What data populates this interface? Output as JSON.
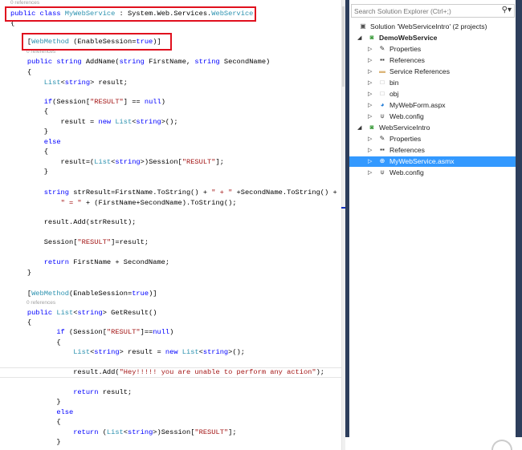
{
  "editor": {
    "codelens": [
      "0 references",
      "0 references",
      "0 references"
    ],
    "lines": [
      [
        {
          "t": "public class ",
          "c": "kw"
        },
        {
          "t": "MyWebService",
          "c": "type"
        },
        {
          "t": " : System.Web.Services.",
          "c": ""
        },
        {
          "t": "WebService",
          "c": "type"
        }
      ],
      [
        {
          "t": "{",
          "c": ""
        }
      ],
      [
        {
          "t": "    [",
          "c": ""
        },
        {
          "t": "WebMethod",
          "c": "type"
        },
        {
          "t": " (EnableSession=",
          "c": ""
        },
        {
          "t": "true",
          "c": "kw"
        },
        {
          "t": ")]",
          "c": ""
        }
      ],
      [
        {
          "t": "    public string ",
          "c": "kw"
        },
        {
          "t": "AddName(",
          "c": ""
        },
        {
          "t": "string ",
          "c": "kw"
        },
        {
          "t": "FirstName, ",
          "c": ""
        },
        {
          "t": "string ",
          "c": "kw"
        },
        {
          "t": "SecondName)",
          "c": ""
        }
      ],
      [
        {
          "t": "    {",
          "c": ""
        }
      ],
      [
        {
          "t": "        List",
          "c": "type"
        },
        {
          "t": "<",
          "c": ""
        },
        {
          "t": "string",
          "c": "kw"
        },
        {
          "t": "> result;",
          "c": ""
        }
      ],
      [
        {
          "t": "        if",
          "c": "kw"
        },
        {
          "t": "(Session[",
          "c": ""
        },
        {
          "t": "\"RESULT\"",
          "c": "str"
        },
        {
          "t": "] == ",
          "c": ""
        },
        {
          "t": "null",
          "c": "kw"
        },
        {
          "t": ")",
          "c": ""
        }
      ],
      [
        {
          "t": "        {",
          "c": ""
        }
      ],
      [
        {
          "t": "            result = ",
          "c": ""
        },
        {
          "t": "new ",
          "c": "kw"
        },
        {
          "t": "List",
          "c": "type"
        },
        {
          "t": "<",
          "c": ""
        },
        {
          "t": "string",
          "c": "kw"
        },
        {
          "t": ">();",
          "c": ""
        }
      ],
      [
        {
          "t": "        }",
          "c": ""
        }
      ],
      [
        {
          "t": "        else",
          "c": "kw"
        }
      ],
      [
        {
          "t": "        {",
          "c": ""
        }
      ],
      [
        {
          "t": "            result=(",
          "c": ""
        },
        {
          "t": "List",
          "c": "type"
        },
        {
          "t": "<",
          "c": ""
        },
        {
          "t": "string",
          "c": "kw"
        },
        {
          "t": ">)Session[",
          "c": ""
        },
        {
          "t": "\"RESULT\"",
          "c": "str"
        },
        {
          "t": "];",
          "c": ""
        }
      ],
      [
        {
          "t": "        }",
          "c": ""
        }
      ],
      [
        {
          "t": "        string ",
          "c": "kw"
        },
        {
          "t": "strResult=FirstName.ToString() + ",
          "c": ""
        },
        {
          "t": "\" + \"",
          "c": "str"
        },
        {
          "t": " +SecondName.ToString() +",
          "c": ""
        }
      ],
      [
        {
          "t": "            ",
          "c": ""
        },
        {
          "t": "\" = \"",
          "c": "str"
        },
        {
          "t": " + (FirstName+SecondName).ToString();",
          "c": ""
        }
      ],
      [
        {
          "t": "        result.Add(strResult);",
          "c": ""
        }
      ],
      [
        {
          "t": "        Session[",
          "c": ""
        },
        {
          "t": "\"RESULT\"",
          "c": "str"
        },
        {
          "t": "]=result;",
          "c": ""
        }
      ],
      [
        {
          "t": "        return ",
          "c": "kw"
        },
        {
          "t": "FirstName + SecondName;",
          "c": ""
        }
      ],
      [
        {
          "t": "    }",
          "c": ""
        }
      ],
      [
        {
          "t": "    [",
          "c": ""
        },
        {
          "t": "WebMethod",
          "c": "type"
        },
        {
          "t": "(EnableSession=",
          "c": ""
        },
        {
          "t": "true",
          "c": "kw"
        },
        {
          "t": ")]",
          "c": ""
        }
      ],
      [
        {
          "t": "    public ",
          "c": "kw"
        },
        {
          "t": "List",
          "c": "type"
        },
        {
          "t": "<",
          "c": ""
        },
        {
          "t": "string",
          "c": "kw"
        },
        {
          "t": "> GetResult()",
          "c": ""
        }
      ],
      [
        {
          "t": "    {",
          "c": ""
        }
      ],
      [
        {
          "t": "           if ",
          "c": "kw"
        },
        {
          "t": "(Session[",
          "c": ""
        },
        {
          "t": "\"RESULT\"",
          "c": "str"
        },
        {
          "t": "]==",
          "c": ""
        },
        {
          "t": "null",
          "c": "kw"
        },
        {
          "t": ")",
          "c": ""
        }
      ],
      [
        {
          "t": "           {",
          "c": ""
        }
      ],
      [
        {
          "t": "               List",
          "c": "type"
        },
        {
          "t": "<",
          "c": ""
        },
        {
          "t": "string",
          "c": "kw"
        },
        {
          "t": "> result = ",
          "c": ""
        },
        {
          "t": "new ",
          "c": "kw"
        },
        {
          "t": "List",
          "c": "type"
        },
        {
          "t": "<",
          "c": ""
        },
        {
          "t": "string",
          "c": "kw"
        },
        {
          "t": ">();",
          "c": ""
        }
      ],
      [
        {
          "t": "               result.Add(",
          "c": ""
        },
        {
          "t": "\"Hey!!!!! you are unable to perform any action\"",
          "c": "str"
        },
        {
          "t": ");",
          "c": ""
        }
      ],
      [
        {
          "t": "               return ",
          "c": "kw"
        },
        {
          "t": "result;",
          "c": ""
        }
      ],
      [
        {
          "t": "           }",
          "c": ""
        }
      ],
      [
        {
          "t": "           else",
          "c": "kw"
        }
      ],
      [
        {
          "t": "           {",
          "c": ""
        }
      ],
      [
        {
          "t": "               return ",
          "c": "kw"
        },
        {
          "t": "(",
          "c": ""
        },
        {
          "t": "List",
          "c": "type"
        },
        {
          "t": "<",
          "c": ""
        },
        {
          "t": "string",
          "c": "kw"
        },
        {
          "t": ">)Session[",
          "c": ""
        },
        {
          "t": "\"RESULT\"",
          "c": "str"
        },
        {
          "t": "];",
          "c": ""
        }
      ],
      [
        {
          "t": "           }",
          "c": ""
        }
      ]
    ]
  },
  "solution_explorer": {
    "search_placeholder": "Search Solution Explorer (Ctrl+;)",
    "items": [
      {
        "label": "Solution 'WebServiceIntro' (2 projects)",
        "icon": "solution-icon",
        "level": 0,
        "expander": "none",
        "bold": false,
        "selected": false
      },
      {
        "label": "DemoWebService",
        "icon": "web-project-icon",
        "level": 0,
        "expander": "expanded",
        "bold": true,
        "selected": false
      },
      {
        "label": "Properties",
        "icon": "wrench-icon",
        "level": 1,
        "expander": "collapsed",
        "bold": false,
        "selected": false
      },
      {
        "label": "References",
        "icon": "references-icon",
        "level": 1,
        "expander": "collapsed",
        "bold": false,
        "selected": false
      },
      {
        "label": "Service References",
        "icon": "folder-icon",
        "level": 1,
        "expander": "collapsed",
        "bold": false,
        "selected": false
      },
      {
        "label": "bin",
        "icon": "folder-outline-icon",
        "level": 1,
        "expander": "collapsed",
        "bold": false,
        "selected": false
      },
      {
        "label": "obj",
        "icon": "folder-outline-icon",
        "level": 1,
        "expander": "collapsed",
        "bold": false,
        "selected": false
      },
      {
        "label": "MyWebForm.aspx",
        "icon": "web-form-icon",
        "level": 1,
        "expander": "collapsed",
        "bold": false,
        "selected": false
      },
      {
        "label": "Web.config",
        "icon": "config-icon",
        "level": 1,
        "expander": "collapsed",
        "bold": false,
        "selected": false
      },
      {
        "label": "WebServiceIntro",
        "icon": "web-project-icon",
        "level": 0,
        "expander": "expanded",
        "bold": false,
        "selected": false
      },
      {
        "label": "Properties",
        "icon": "wrench-icon",
        "level": 1,
        "expander": "collapsed",
        "bold": false,
        "selected": false
      },
      {
        "label": "References",
        "icon": "references-icon",
        "level": 1,
        "expander": "collapsed",
        "bold": false,
        "selected": false
      },
      {
        "label": "MyWebService.asmx",
        "icon": "web-service-icon",
        "level": 1,
        "expander": "collapsed",
        "bold": false,
        "selected": true
      },
      {
        "label": "Web.config",
        "icon": "config-icon",
        "level": 1,
        "expander": "collapsed",
        "bold": false,
        "selected": false
      }
    ]
  }
}
